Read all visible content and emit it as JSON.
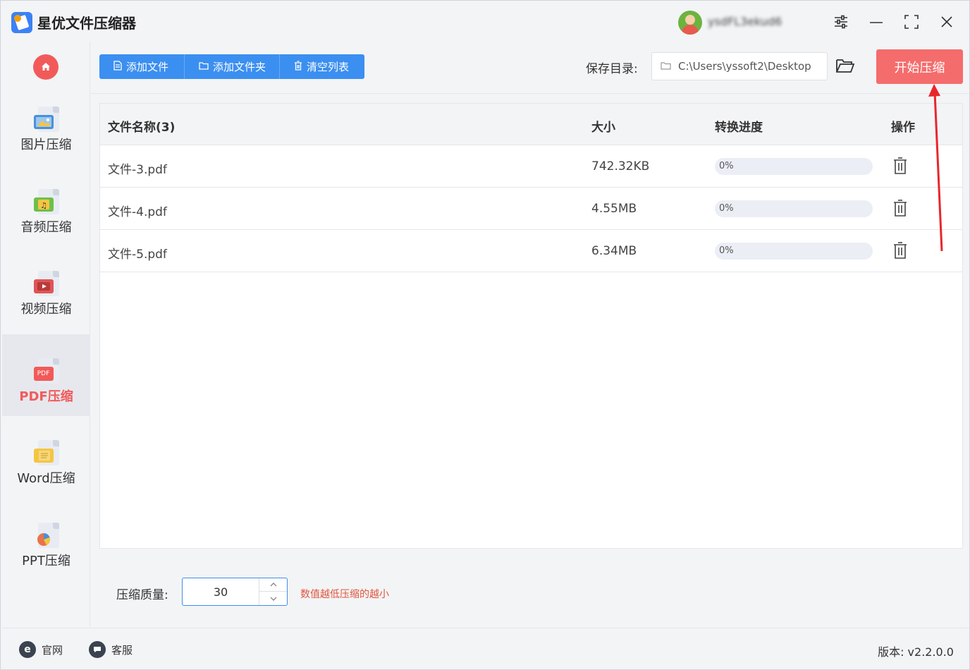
{
  "app": {
    "title": "星优文件压缩器",
    "user_name": "ysdFL3ekud6"
  },
  "sidebar": {
    "home_icon": "home-icon",
    "items": [
      {
        "label": "图片压缩",
        "icon": "image-file-icon",
        "color": "#4a90d9"
      },
      {
        "label": "音频压缩",
        "icon": "audio-file-icon",
        "color": "#6cc04a"
      },
      {
        "label": "视频压缩",
        "icon": "video-file-icon",
        "color": "#e05555"
      },
      {
        "label": "PDF压缩",
        "icon": "pdf-file-icon",
        "color": "#f25a5a",
        "badge": "PDF",
        "active": true
      },
      {
        "label": "Word压缩",
        "icon": "word-file-icon",
        "color": "#f5c542"
      },
      {
        "label": "PPT压缩",
        "icon": "ppt-file-icon",
        "color": "#e8744a"
      }
    ]
  },
  "toolbar": {
    "add_file": "添加文件",
    "add_folder": "添加文件夹",
    "clear_list": "清空列表",
    "save_dir_label": "保存目录:",
    "save_dir_value": "C:\\Users\\yssoft2\\Desktop",
    "start_button": "开始压缩"
  },
  "table": {
    "headers": {
      "name": "文件名称(3)",
      "size": "大小",
      "progress": "转换进度",
      "action": "操作"
    },
    "rows": [
      {
        "name": "文件-3.pdf",
        "size": "742.32KB",
        "progress": "0%",
        "progress_value": 0
      },
      {
        "name": "文件-4.pdf",
        "size": "4.55MB",
        "progress": "0%",
        "progress_value": 0
      },
      {
        "name": "文件-5.pdf",
        "size": "6.34MB",
        "progress": "0%",
        "progress_value": 0
      }
    ]
  },
  "quality": {
    "label": "压缩质量:",
    "value": "30",
    "hint": "数值越低压缩的越小"
  },
  "footer": {
    "website": "官网",
    "support": "客服",
    "version": "版本: v2.2.0.0"
  },
  "colors": {
    "accent": "#3b8ff0",
    "danger": "#f56c6c",
    "hint": "#e0553c"
  }
}
